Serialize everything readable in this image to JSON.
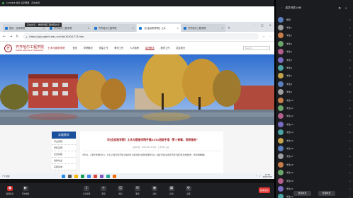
{
  "meeting": {
    "bar_text": "12346/8 共享 演示屏幕 · 正在共享",
    "overlay_title": "正在共享",
    "overlay_sub": "教师管理工程学院共享"
  },
  "browser": {
    "tabs": [
      {
        "label": "首页 - 空间学院"
      },
      {
        "label": "齐齐哈尔工程学院"
      },
      {
        "label": "齐齐哈尔工程学院"
      },
      {
        "label": "【社会实践学院】土木"
      },
      {
        "label": "齐齐哈尔工程学院"
      }
    ],
    "url": "https://jyjp.qqhrit.edu.cn/info/1040/1273.htm"
  },
  "site": {
    "logo_char": "齐",
    "brand": "齐齐哈尔工程学院",
    "brand_en": "Qiqihar Institute of Engineering",
    "college": "土木与营造学院",
    "nav": [
      "首页",
      "学院概况",
      "党建工作",
      "教学工作",
      "人才培养",
      "实践教学",
      "团学工作",
      "招生就业"
    ],
    "nav_active": 5,
    "search_placeholder": "Search..."
  },
  "content": {
    "side_title": "实践教学",
    "side_items": [
      "专业实践",
      "学科竞赛",
      "社会实践",
      "创新创业",
      "实践基地"
    ],
    "article_title": "【社会实践学院】土木与营造学院开展2331班级手语 \"萝卜青春，同伴服务\"",
    "article_meta": "发布时间：2023-03-12  作者：土木学院  点击：",
    "article_body": "3月5日，正值学雷锋纪念日，土木与营造学院开展\"青春向党 奉献有我\"主题志愿服务活动，组织学生走进社区开展手语宣传及志愿服务，传承雷锋精神。"
  },
  "taskbar": {
    "weather": "7°C 晴朗",
    "time": "11:30",
    "date": "2023/3/13"
  },
  "controls": {
    "items": [
      "解除静音",
      "开启视频",
      "共享屏幕",
      "邀请",
      "成员",
      "聊天",
      "录制",
      "应用",
      "设置"
    ],
    "end_label": "结束会议"
  },
  "panel": {
    "title": "成员列表 (46)",
    "members": [
      "教师",
      "学生1",
      "学生2",
      "学生3",
      "学生4",
      "学生5",
      "学生6",
      "学生7",
      "学生8",
      "学生9",
      "学生10",
      "学生11",
      "学生12",
      "学生13",
      "学生14",
      "学生15",
      "学生16",
      "学生17",
      "学生18",
      "学生19",
      "学生20",
      "学生21",
      "学生22"
    ],
    "invite_label": "邀请成员",
    "manage_label": "管理成员"
  },
  "colors": {
    "brand_red": "#a31d22",
    "side_blue": "#1a4f9c",
    "end_red": "#e53935"
  }
}
